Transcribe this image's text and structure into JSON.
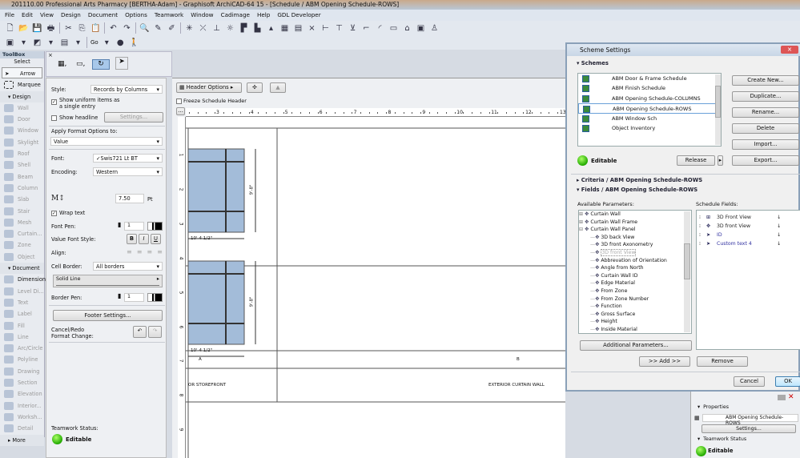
{
  "window": {
    "title": "201110.00 Professional Arts Pharmacy  [BERTHA-Adam] - Graphisoft ArchiCAD-64 15 - [Schedule /  ABM Opening Schedule-ROWS]"
  },
  "menu": [
    "File",
    "Edit",
    "View",
    "Design",
    "Document",
    "Options",
    "Teamwork",
    "Window",
    "Cadimage",
    "Help",
    "GDL Developer"
  ],
  "toolbar1": [
    "new-icon",
    "open-icon",
    "save-icon",
    "print-icon",
    "cut-icon",
    "copy-icon",
    "paste-icon",
    "undo-icon",
    "redo-icon",
    "find-icon",
    "eyedropper-icon",
    "syringe-icon",
    "magic-wand-icon",
    "trim-icon",
    "elevate-icon",
    "sun-icon",
    "layer-icon",
    "stack-icon",
    "pen-icon",
    "fill-icon",
    "grid-icon",
    "close-icon",
    "dimension-icon",
    "align-icon",
    "distribute-icon",
    "fillet-icon",
    "arc-icon",
    "window-icon",
    "home-icon",
    "schedule-icon",
    "person-icon"
  ],
  "toolbar2": {
    "go_label": "Go"
  },
  "toolbox": {
    "title": "ToolBox",
    "select": "Select",
    "arrow": "Arrow",
    "marquee": "Marquee",
    "design": "Design",
    "design_items": [
      "Wall",
      "Door",
      "Window",
      "Skylight",
      "Roof",
      "Shell",
      "Beam",
      "Column",
      "Slab",
      "Stair",
      "Mesh",
      "Curtain...",
      "Zone",
      "Object"
    ],
    "document": "Document",
    "document_items": [
      "Dimension",
      "Level Di...",
      "Text",
      "Label",
      "Fill",
      "Line",
      "Arc/Circle",
      "Polyline",
      "Drawing",
      "Section",
      "Elevation",
      "Interior...",
      "Worksh...",
      "Detail"
    ],
    "more": "More"
  },
  "panel": {
    "style_label": "Style:",
    "style_value": "Records by Columns",
    "uniform_label": "Show uniform items as a single entry",
    "uniform_checked": true,
    "headline_label": "Show headline",
    "headline_checked": false,
    "settings_button": "Settings...",
    "apply_label": "Apply Format Options to:",
    "apply_value": "Value",
    "font_label": "Font:",
    "font_value": "✓Swis721 Lt BT",
    "encoding_label": "Encoding:",
    "encoding_value": "Western",
    "size_value": "7.50",
    "size_unit": "Pt",
    "wrap_label": "Wrap text",
    "wrap_checked": true,
    "font_pen_label": "Font Pen:",
    "font_pen_value": "1",
    "value_font_style_label": "Value Font Style:",
    "bold": "B",
    "italic": "I",
    "underline": "U",
    "align_label": "Align:",
    "cell_border_label": "Cell Border:",
    "cell_border_value": "All borders",
    "line_type": "Solid Line",
    "border_pen_label": "Border Pen:",
    "border_pen_value": "1",
    "footer_button": "Footer Settings...",
    "cancel_redo_label": "Cancel/Redo Format Change:",
    "teamwork_label": "Teamwork Status:",
    "teamwork_value": "Editable"
  },
  "schedule": {
    "header_options": "Header Options",
    "freeze_label": "Freeze Schedule Header",
    "hruler": [
      "3",
      "4",
      "5",
      "6",
      "7",
      "8",
      "9",
      "10",
      "11",
      "12",
      "13"
    ],
    "vruler": [
      "1",
      "2",
      "3",
      "4",
      "5",
      "6",
      "7",
      "8",
      "9"
    ],
    "dim_width": "10'-4 1/2\"",
    "dim_height": "9'-8\"",
    "col_a": "A",
    "col_b": "B",
    "cell_a": "OR STOREFRONT",
    "cell_b": "EXTERIOR CURTAIN WALL"
  },
  "dialog": {
    "title": "Scheme Settings",
    "schemes_header": "Schemes",
    "schemes": [
      "ABM Door & Frame Schedule",
      "ABM Finish Schedule",
      "ABM Opening Schedule-COLUMNS",
      "ABM Opening Schedule-ROWS",
      "ABM Window Sch",
      "Object Inventory"
    ],
    "selected_scheme": "ABM Opening Schedule-ROWS",
    "buttons": [
      "Create New...",
      "Duplicate...",
      "Rename...",
      "Delete",
      "Import...",
      "Export..."
    ],
    "status": "Editable",
    "release": "Release",
    "criteria_header": "Criteria /  ABM Opening Schedule-ROWS",
    "fields_header": "Fields /  ABM Opening Schedule-ROWS",
    "available_label": "Available Parameters:",
    "schedule_fields_label": "Schedule Fields:",
    "tree_groups": [
      "Curtain Wall",
      "Curtain Wall Frame",
      "Curtain Wall Panel"
    ],
    "tree_items": [
      "3D back View",
      "3D front Axonometry",
      "3D front View",
      "Abbrevation of Orientation",
      "Angle from North",
      "Curtain Wall ID",
      "Edge Material",
      "From Zone",
      "From Zone Number",
      "Function",
      "Gross Surface",
      "Height",
      "Inside Material"
    ],
    "schedule_fields": [
      {
        "label": "3D Front View",
        "color": "#222"
      },
      {
        "label": "3D front View",
        "color": "#222"
      },
      {
        "label": "ID",
        "color": "#3030a0"
      },
      {
        "label": "Custom text  4",
        "color": "#3030a0"
      }
    ],
    "additional_button": "Additional Parameters...",
    "add_button": ">> Add >>",
    "remove_button": "Remove",
    "cancel_button": "Cancel",
    "ok_button": "OK"
  },
  "bottom_panel": {
    "properties": "Properties",
    "scheme_name": "ABM Opening Schedule-ROWS",
    "settings": "Settings...",
    "teamwork": "Teamwork Status",
    "status": "Editable"
  }
}
